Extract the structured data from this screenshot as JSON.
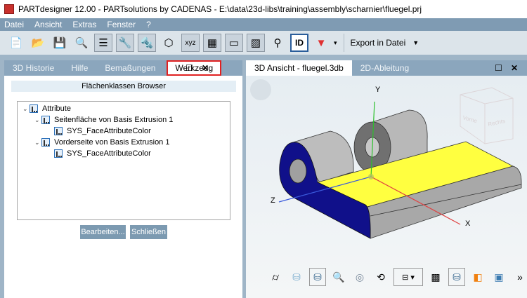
{
  "window": {
    "title": "PARTdesigner 12.00 - PARTsolutions by CADENAS - E:\\data\\23d-libs\\training\\assembly\\scharnier\\fluegel.prj"
  },
  "menu": [
    "Datei",
    "Ansicht",
    "Extras",
    "Fenster",
    "?"
  ],
  "toolbar": {
    "export_label": "Export in Datei",
    "id_label": "ID"
  },
  "left_panel": {
    "tabs": [
      "3D Historie",
      "Hilfe",
      "Bemaßungen",
      "Werkzeug"
    ],
    "active_tab": "Werkzeug",
    "maximize": "☐",
    "close": "✕",
    "browser_title": "Flächenklassen Browser",
    "tree": [
      {
        "label": "Attribute"
      },
      {
        "label": "Seitenfläche von Basis Extrusion 1"
      },
      {
        "label": "SYS_FaceAttributeColor"
      },
      {
        "label": "Vorderseite von Basis Extrusion 1"
      },
      {
        "label": "SYS_FaceAttributeColor"
      }
    ],
    "buttons": {
      "edit": "Bearbeiten...",
      "close": "Schließen"
    }
  },
  "right_panel": {
    "tabs": [
      "3D Ansicht - fluegel.3db",
      "2D-Ableitung"
    ],
    "maximize": "☐",
    "close": "✕",
    "axes": {
      "x": "X",
      "y": "Y",
      "z": "Z"
    },
    "viewcube": {
      "front": "Vorne",
      "right": "Rechts"
    },
    "more": "»"
  },
  "colors": {
    "highlight_face": "#ffff40",
    "front_face": "#10108a",
    "tab_highlight": "#e02020"
  }
}
